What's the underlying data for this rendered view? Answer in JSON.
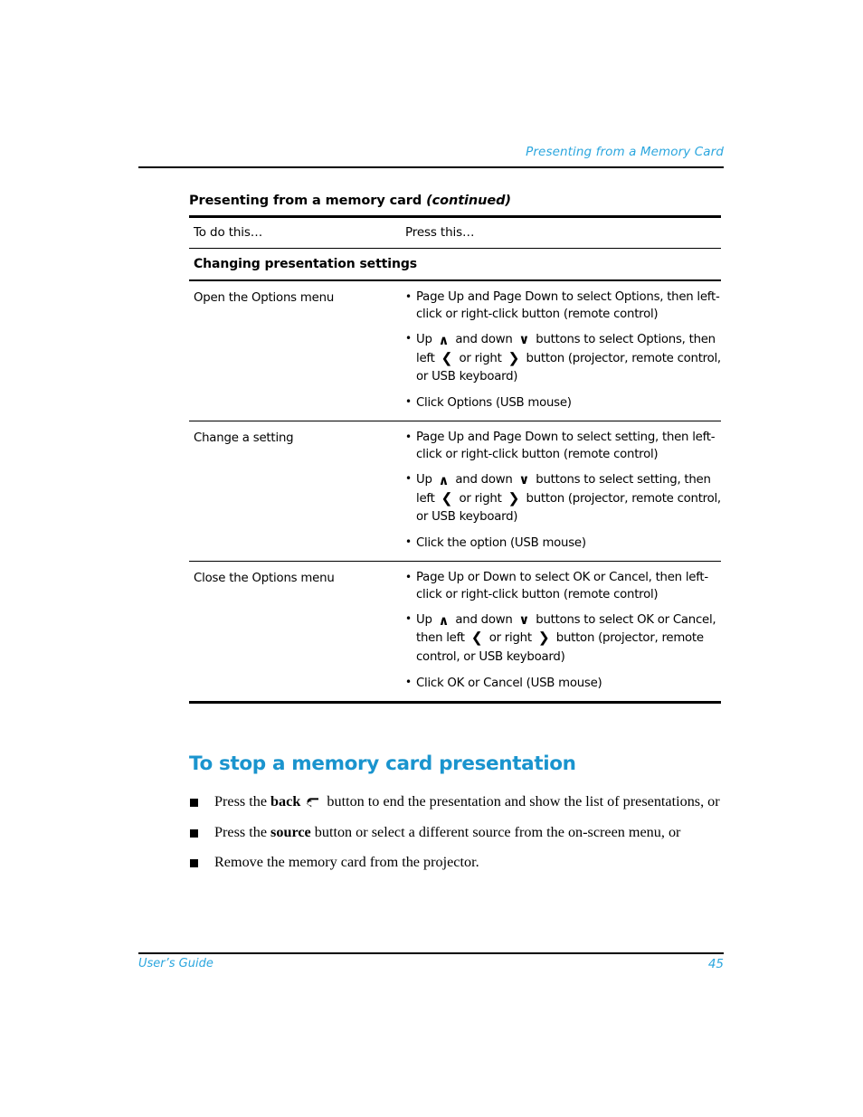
{
  "colors": {
    "accent": "#2ba6de",
    "heading": "#1a94ce",
    "rule": "#000000"
  },
  "running_header": {
    "text": "Presenting from a Memory Card"
  },
  "table": {
    "title_main": "Presenting from a memory card ",
    "title_continued": "(continued)",
    "columns": {
      "left": "To do this…",
      "right": "Press this…"
    },
    "section_heading": "Changing presentation settings",
    "rows": [
      {
        "task": "Open the Options menu",
        "bullets": [
          {
            "parts": [
              {
                "t": "Page Up and Page Down to select Options, then left-click or right-click button (remote control)"
              }
            ]
          },
          {
            "tall": true,
            "parts": [
              {
                "t": "Up "
              },
              {
                "key": "up"
              },
              {
                "t": " and down "
              },
              {
                "key": "down"
              },
              {
                "t": " buttons to select Options, then left "
              },
              {
                "key": "left"
              },
              {
                "t": " or right "
              },
              {
                "key": "right"
              },
              {
                "t": " button (projector, remote control, or USB keyboard)"
              }
            ]
          },
          {
            "parts": [
              {
                "t": "Click Options (USB mouse)"
              }
            ]
          }
        ]
      },
      {
        "task": "Change a setting",
        "bullets": [
          {
            "parts": [
              {
                "t": "Page Up and Page Down to select setting, then left-click or right-click button (remote control)"
              }
            ]
          },
          {
            "tall": true,
            "parts": [
              {
                "t": "Up "
              },
              {
                "key": "up"
              },
              {
                "t": " and down "
              },
              {
                "key": "down"
              },
              {
                "t": " buttons to select setting, then left "
              },
              {
                "key": "left"
              },
              {
                "t": " or right "
              },
              {
                "key": "right"
              },
              {
                "t": " button (projector, remote control, or USB keyboard)"
              }
            ]
          },
          {
            "parts": [
              {
                "t": "Click the option (USB mouse)"
              }
            ]
          }
        ]
      },
      {
        "task": "Close the Options menu",
        "bullets": [
          {
            "parts": [
              {
                "t": "Page Up or Down to select OK or Cancel, then left-click or right-click button (remote control)"
              }
            ]
          },
          {
            "tall": true,
            "parts": [
              {
                "t": "Up "
              },
              {
                "key": "up"
              },
              {
                "t": " and down "
              },
              {
                "key": "down"
              },
              {
                "t": " buttons to select OK or Cancel, then left "
              },
              {
                "key": "left"
              },
              {
                "t": " or right "
              },
              {
                "key": "right"
              },
              {
                "t": " button (projector, remote control, or USB keyboard)"
              }
            ]
          },
          {
            "parts": [
              {
                "t": "Click OK or Cancel (USB mouse)"
              }
            ]
          }
        ]
      }
    ]
  },
  "section": {
    "heading": "To stop a memory card presentation",
    "items": [
      {
        "parts": [
          {
            "t": "Press the "
          },
          {
            "t": "back",
            "b": true
          },
          {
            "icon": "back-arrow-icon"
          },
          {
            "t": " button to end the presentation and show the list of presentations, or"
          }
        ]
      },
      {
        "parts": [
          {
            "t": "Press the "
          },
          {
            "t": "source",
            "b": true
          },
          {
            "t": " button or select a different source from the on-screen menu, or"
          }
        ]
      },
      {
        "parts": [
          {
            "t": "Remove the memory card from the projector."
          }
        ]
      }
    ]
  },
  "footer": {
    "left": "User’s Guide",
    "page": "45"
  },
  "key_glyphs": {
    "up": "∧",
    "down": "∨",
    "left": "❮",
    "right": "❯"
  }
}
